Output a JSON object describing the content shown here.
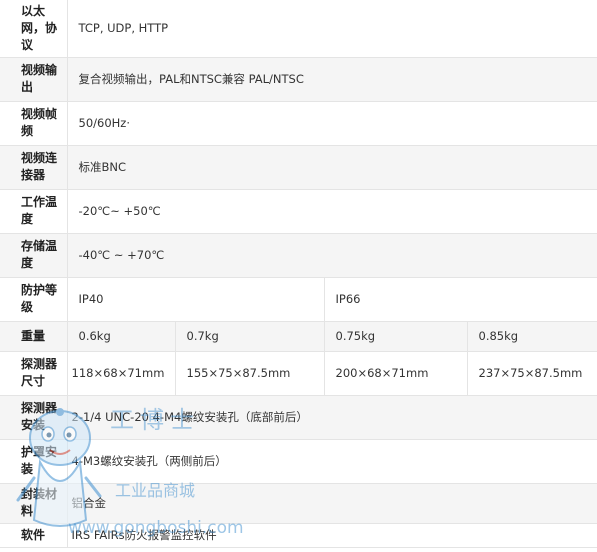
{
  "rows": [
    {
      "label": "以太网，协议",
      "values": [
        "TCP, UDP, HTTP"
      ]
    },
    {
      "label": "视频输出",
      "values": [
        "复合视频输出，PAL和NTSC兼容 PAL/NTSC"
      ]
    },
    {
      "label": "视频帧频",
      "values": [
        "50/60Hz·"
      ]
    },
    {
      "label": "视频连接器",
      "values": [
        "标准BNC"
      ]
    },
    {
      "label": "工作温度",
      "values": [
        "-20℃~ +50℃"
      ]
    },
    {
      "label": "存储温度",
      "values": [
        "-40℃ ~ +70℃"
      ]
    },
    {
      "label": "防护等级",
      "values": [
        "IP40",
        "IP66"
      ]
    },
    {
      "label": "重量",
      "values": [
        "0.6kg",
        "0.7kg",
        "0.75kg",
        "0.85kg"
      ]
    },
    {
      "label": "探测器尺寸",
      "values": [
        "118×68×71mm",
        "155×75×87.5mm",
        "200×68×71mm",
        "237×75×87.5mm"
      ]
    },
    {
      "label": "探测器安装",
      "values": [
        "2-1/4 UNC-20  4-M4螺纹安装孔（底部前后）"
      ]
    },
    {
      "label": "护罩安装",
      "values": [
        "4-M3螺纹安装孔（两侧前后）"
      ]
    },
    {
      "label": "封装材料",
      "values": [
        "铝合金"
      ]
    },
    {
      "label": "软件",
      "values": [
        "IRS FAIRs防火报警监控软件"
      ]
    }
  ],
  "watermark": {
    "brand": "工博士",
    "slogan": "工业品商城",
    "url": "www.gongboshi.com"
  },
  "colors": {
    "row_alt": "#f5f5f5",
    "border": "#e4e4e4",
    "watermark_blue": "#3f8fcf"
  }
}
